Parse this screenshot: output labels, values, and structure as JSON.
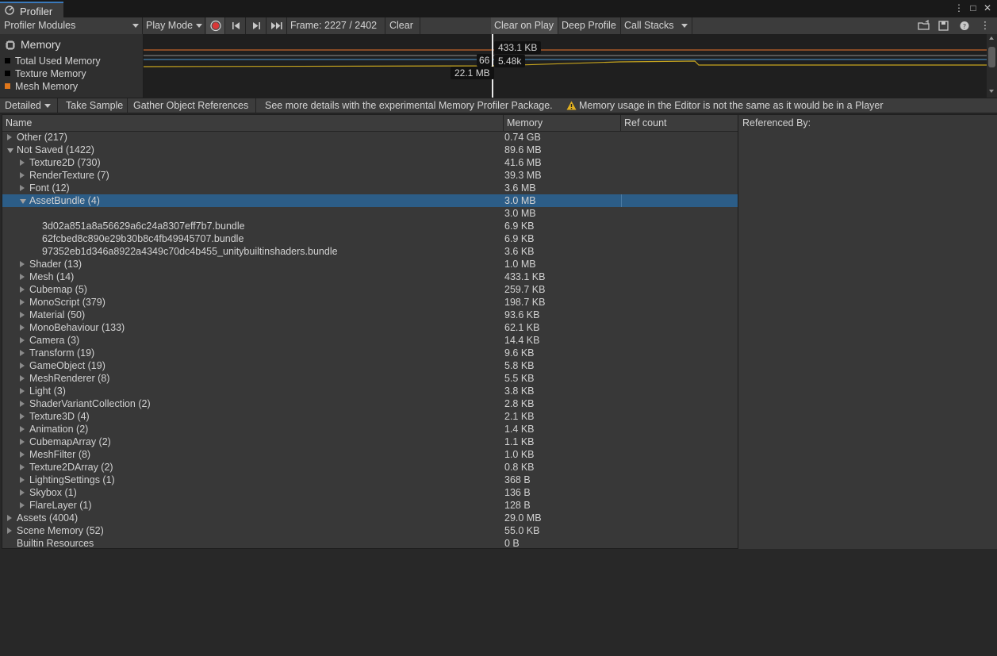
{
  "window": {
    "tab_title": "Profiler"
  },
  "toolbar": {
    "modules_label": "Profiler Modules",
    "play_mode_label": "Play Mode",
    "frame_label": "Frame: 2227 / 2402",
    "clear_label": "Clear",
    "clear_on_play_label": "Clear on Play",
    "deep_profile_label": "Deep Profile",
    "call_stacks_label": "Call Stacks"
  },
  "module": {
    "title": "Memory",
    "legend": [
      {
        "label": "Total Used Memory",
        "color": "#000000"
      },
      {
        "label": "Texture Memory",
        "color": "#000000"
      },
      {
        "label": "Mesh Memory",
        "color": "#e0771b"
      }
    ]
  },
  "graph": {
    "flags": [
      {
        "text": "433.1 KB"
      },
      {
        "text": "66"
      },
      {
        "text": "5.48k"
      },
      {
        "text": "22.1 MB"
      }
    ],
    "line_colors": [
      "#c4652b",
      "#8e8e8e",
      "#4c9ad3",
      "#c6a41f"
    ]
  },
  "toolbar2": {
    "view_label": "Detailed",
    "take_sample_label": "Take Sample",
    "gather_label": "Gather Object References",
    "package_msg": "See more details with the experimental Memory Profiler Package.",
    "warning_msg": "Memory usage in the Editor is not the same as it would be in a Player"
  },
  "tree": {
    "headers": {
      "name": "Name",
      "memory": "Memory",
      "refcount": "Ref count"
    },
    "rows": [
      {
        "name": "Other (217)",
        "mem": "0.74 GB"
      },
      {
        "name": "Not Saved (1422)",
        "mem": "89.6 MB"
      },
      {
        "name": "Texture2D (730)",
        "mem": "41.6 MB"
      },
      {
        "name": "RenderTexture (7)",
        "mem": "39.3 MB"
      },
      {
        "name": "Font (12)",
        "mem": "3.6 MB"
      },
      {
        "name": "AssetBundle (4)",
        "mem": "3.0 MB"
      },
      {
        "name": "",
        "mem": "3.0 MB"
      },
      {
        "name": "3d02a851a8a56629a6c24a8307eff7b7.bundle",
        "mem": "6.9 KB"
      },
      {
        "name": "62fcbed8c890e29b30b8c4fb49945707.bundle",
        "mem": "6.9 KB"
      },
      {
        "name": "97352eb1d346a8922a4349c70dc4b455_unitybuiltinshaders.bundle",
        "mem": "3.6 KB"
      },
      {
        "name": "Shader (13)",
        "mem": "1.0 MB"
      },
      {
        "name": "Mesh (14)",
        "mem": "433.1 KB"
      },
      {
        "name": "Cubemap (5)",
        "mem": "259.7 KB"
      },
      {
        "name": "MonoScript (379)",
        "mem": "198.7 KB"
      },
      {
        "name": "Material (50)",
        "mem": "93.6 KB"
      },
      {
        "name": "MonoBehaviour (133)",
        "mem": "62.1 KB"
      },
      {
        "name": "Camera (3)",
        "mem": "14.4 KB"
      },
      {
        "name": "Transform (19)",
        "mem": "9.6 KB"
      },
      {
        "name": "GameObject (19)",
        "mem": "5.8 KB"
      },
      {
        "name": "MeshRenderer (8)",
        "mem": "5.5 KB"
      },
      {
        "name": "Light (3)",
        "mem": "3.8 KB"
      },
      {
        "name": "ShaderVariantCollection (2)",
        "mem": "2.8 KB"
      },
      {
        "name": "Texture3D (4)",
        "mem": "2.1 KB"
      },
      {
        "name": "Animation (2)",
        "mem": "1.4 KB"
      },
      {
        "name": "CubemapArray (2)",
        "mem": "1.1 KB"
      },
      {
        "name": "MeshFilter (8)",
        "mem": "1.0 KB"
      },
      {
        "name": "Texture2DArray (2)",
        "mem": "0.8 KB"
      },
      {
        "name": "LightingSettings (1)",
        "mem": "368 B"
      },
      {
        "name": "Skybox (1)",
        "mem": "136 B"
      },
      {
        "name": "FlareLayer (1)",
        "mem": "128 B"
      },
      {
        "name": "Assets (4004)",
        "mem": "29.0 MB"
      },
      {
        "name": "Scene Memory (52)",
        "mem": "55.0 KB"
      },
      {
        "name": "Builtin Resources",
        "mem": "0 B"
      }
    ]
  },
  "refs": {
    "title": "Referenced By:"
  }
}
